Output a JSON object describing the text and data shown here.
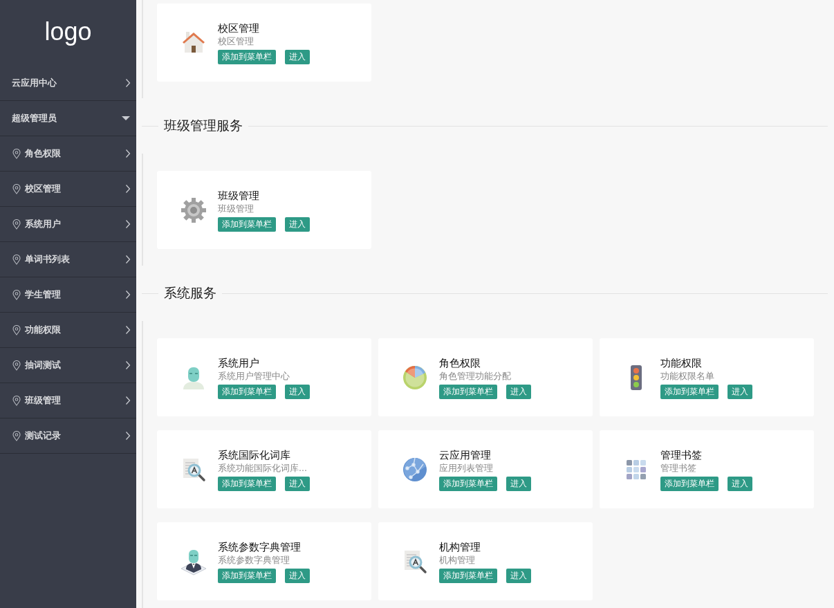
{
  "sidebar": {
    "logo": "logo",
    "items": [
      {
        "kind": "group",
        "label": "云应用中心",
        "expanded": false
      },
      {
        "kind": "group",
        "label": "超级管理员",
        "expanded": true
      },
      {
        "kind": "item",
        "label": "角色权限"
      },
      {
        "kind": "item",
        "label": "校区管理"
      },
      {
        "kind": "item",
        "label": "系统用户"
      },
      {
        "kind": "item",
        "label": "单词书列表"
      },
      {
        "kind": "item",
        "label": "学生管理"
      },
      {
        "kind": "item",
        "label": "功能权限"
      },
      {
        "kind": "item",
        "label": "抽词测试"
      },
      {
        "kind": "item",
        "label": "班级管理"
      },
      {
        "kind": "item",
        "label": "测试记录"
      }
    ]
  },
  "sections": [
    {
      "cards": [
        {
          "kind": "house",
          "title": "校区管理",
          "description": "校区管理",
          "add_button": "添加到菜单栏",
          "enter_button": "进入"
        }
      ]
    },
    {
      "title": "班级管理服务",
      "cards": [
        {
          "kind": "gear",
          "title": "班级管理",
          "description": "班级管理",
          "add_button": "添加到菜单栏",
          "enter_button": "进入"
        }
      ]
    },
    {
      "title": "系统服务",
      "cards": [
        {
          "kind": "person",
          "title": "系统用户",
          "description": "系统用户管理中心",
          "add_button": "添加到菜单栏",
          "enter_button": "进入"
        },
        {
          "kind": "pie",
          "title": "角色权限",
          "description": "角色管理功能分配",
          "add_button": "添加到菜单栏",
          "enter_button": "进入"
        },
        {
          "kind": "traffic-light",
          "title": "功能权限",
          "description": "功能权限名单",
          "add_button": "添加到菜单栏",
          "enter_button": "进入"
        },
        {
          "kind": "magnifier",
          "title": "系统国际化词库",
          "description": "系统功能国际化词库...",
          "add_button": "添加到菜单栏",
          "enter_button": "进入"
        },
        {
          "kind": "globe",
          "title": "云应用管理",
          "description": "应用列表管理",
          "add_button": "添加到菜单栏",
          "enter_button": "进入"
        },
        {
          "kind": "grid",
          "title": "管理书签",
          "description": "管理书签",
          "add_button": "添加到菜单栏",
          "enter_button": "进入"
        },
        {
          "kind": "person-tie",
          "title": "系统参数字典管理",
          "description": "系统参数字典管理",
          "add_button": "添加到菜单栏",
          "enter_button": "进入"
        },
        {
          "kind": "magnifier",
          "title": "机构管理",
          "description": "机构管理",
          "add_button": "添加到菜单栏",
          "enter_button": "进入"
        }
      ]
    }
  ]
}
